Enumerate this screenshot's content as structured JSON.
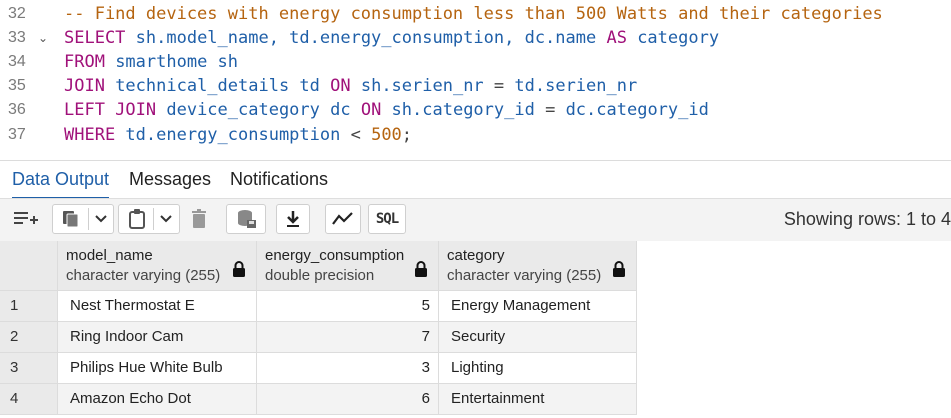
{
  "editor": {
    "lines": [
      {
        "num": "32",
        "fold": "",
        "segments": [
          {
            "t": "-- Find devices with energy consumption less than 500 Watts and their categories",
            "c": "cm"
          }
        ]
      },
      {
        "num": "33",
        "fold": "⌄",
        "segments": [
          {
            "t": "SELECT ",
            "c": "kw"
          },
          {
            "t": "sh.model_name, td.energy_consumption, dc.name ",
            "c": "id"
          },
          {
            "t": "AS ",
            "c": "kw"
          },
          {
            "t": "category",
            "c": "id"
          }
        ]
      },
      {
        "num": "34",
        "fold": "",
        "segments": [
          {
            "t": "FROM ",
            "c": "kw"
          },
          {
            "t": "smarthome sh",
            "c": "id"
          }
        ]
      },
      {
        "num": "35",
        "fold": "",
        "segments": [
          {
            "t": "JOIN ",
            "c": "kw"
          },
          {
            "t": "technical_details td ",
            "c": "id"
          },
          {
            "t": "ON ",
            "c": "kw"
          },
          {
            "t": "sh.serien_nr ",
            "c": "id"
          },
          {
            "t": "= ",
            "c": "op"
          },
          {
            "t": "td.serien_nr",
            "c": "id"
          }
        ]
      },
      {
        "num": "36",
        "fold": "",
        "segments": [
          {
            "t": "LEFT JOIN ",
            "c": "kw"
          },
          {
            "t": "device_category dc ",
            "c": "id"
          },
          {
            "t": "ON ",
            "c": "kw"
          },
          {
            "t": "sh.category_id ",
            "c": "id"
          },
          {
            "t": "= ",
            "c": "op"
          },
          {
            "t": "dc.category_id",
            "c": "id"
          }
        ]
      },
      {
        "num": "37",
        "fold": "",
        "segments": [
          {
            "t": "WHERE ",
            "c": "kw"
          },
          {
            "t": "td.energy_consumption ",
            "c": "id"
          },
          {
            "t": "< ",
            "c": "op"
          },
          {
            "t": "500",
            "c": "num"
          },
          {
            "t": ";",
            "c": "op"
          }
        ]
      }
    ]
  },
  "tabs": [
    {
      "label": "Data Output",
      "active": true
    },
    {
      "label": "Messages",
      "active": false
    },
    {
      "label": "Notifications",
      "active": false
    }
  ],
  "toolbar": {
    "sql_label": "SQL",
    "rows_info": "Showing rows: 1 to 4"
  },
  "grid": {
    "columns": [
      {
        "name": "model_name",
        "type": "character varying (255)"
      },
      {
        "name": "energy_consumption",
        "type": "double precision"
      },
      {
        "name": "category",
        "type": "character varying (255)"
      }
    ],
    "rows": [
      {
        "n": "1",
        "model_name": "Nest Thermostat E",
        "energy_consumption": "5",
        "category": "Energy Management"
      },
      {
        "n": "2",
        "model_name": "Ring Indoor Cam",
        "energy_consumption": "7",
        "category": "Security"
      },
      {
        "n": "3",
        "model_name": "Philips Hue White Bulb",
        "energy_consumption": "3",
        "category": "Lighting"
      },
      {
        "n": "4",
        "model_name": "Amazon Echo Dot",
        "energy_consumption": "6",
        "category": "Entertainment"
      }
    ]
  },
  "colors": {
    "keyword": "#a0117a",
    "comment": "#b56410",
    "identifier": "#1f5fa8",
    "active_tab": "#1f5fa8"
  }
}
